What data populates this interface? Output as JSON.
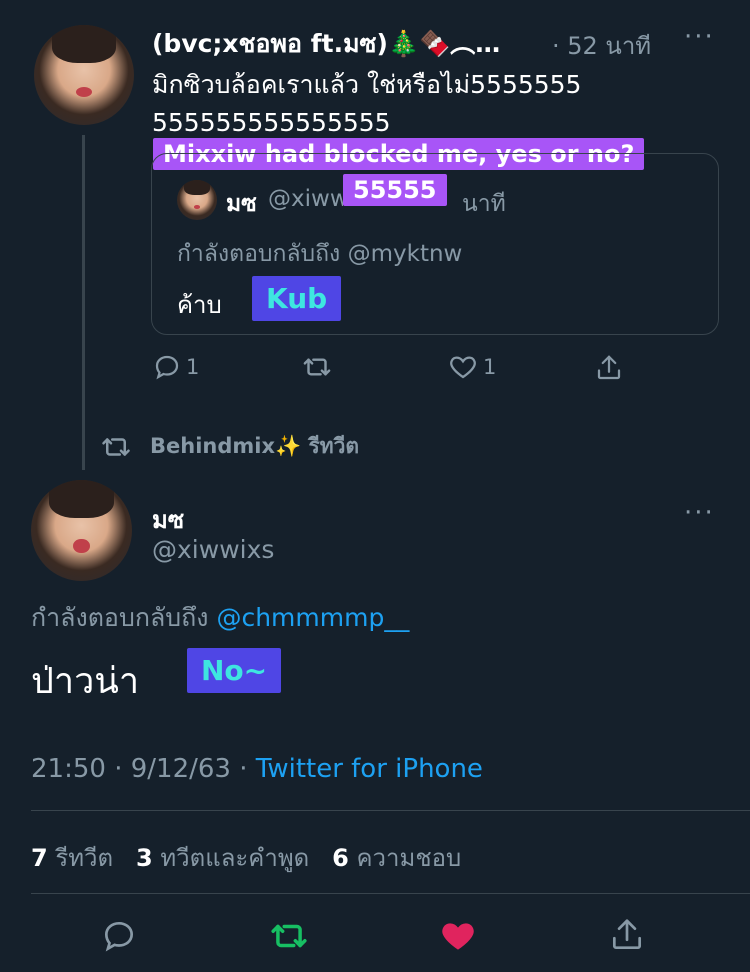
{
  "tweet1": {
    "display_name": "(bvc;xชอพอ ft.มซ)🎄🍫︵…",
    "time": "· 52 นาที",
    "text": "มิกซิวบล้อคเราแล้ว ใช่หรือไม่5555555555555555555555",
    "annotation_line1": "Mixxiw had blocked me, yes or no?",
    "annotation_line2": "55555",
    "actions": {
      "reply_count": "1",
      "like_count": "1"
    }
  },
  "quote": {
    "name": "มซ",
    "handle": "@xiwwixs",
    "time": "นาที",
    "replying_to": "กำลังตอบกลับถึง @myktnw",
    "text": "ค้าบ",
    "annotation": "Kub"
  },
  "retweet_context": {
    "text": "Behindmix✨ รีทวีต"
  },
  "tweet2": {
    "name": "มซ",
    "handle": "@xiwwixs",
    "replying_label": "กำลังตอบกลับถึง",
    "replying_handle": "@chmmmmp__",
    "text": "ป่าวน่า",
    "annotation": "No~",
    "timestamp": "21:50 · 9/12/63 ·",
    "source": "Twitter for iPhone",
    "stats": {
      "retweets_count": "7",
      "retweets_label": "รีทวีต",
      "quotes_count": "3",
      "quotes_label": "ทวีตและคำพูด",
      "likes_count": "6",
      "likes_label": "ความชอบ"
    }
  },
  "colors": {
    "background": "#15202b",
    "muted": "#8899a6",
    "link": "#1da1f2",
    "retweet_active": "#17bf63",
    "like_active": "#e0245e"
  }
}
